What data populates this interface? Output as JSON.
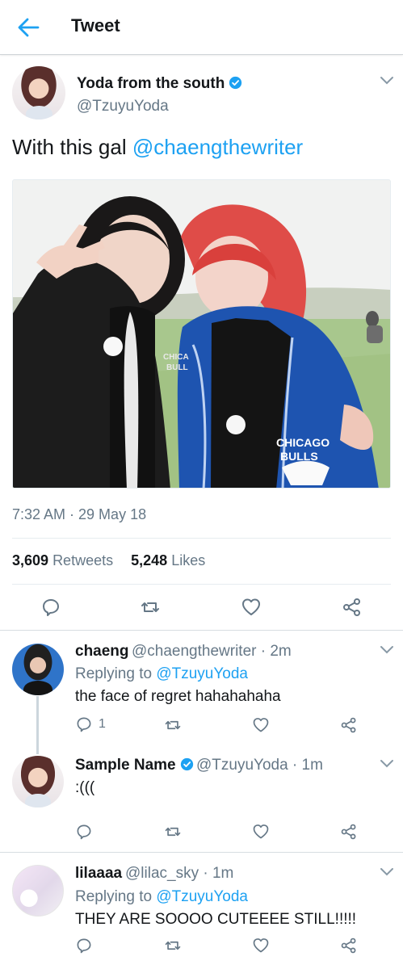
{
  "header": {
    "title": "Tweet"
  },
  "tweet": {
    "author_name": "Yoda from the south",
    "author_handle": "@TzuyuYoda",
    "text_prefix": "With this gal ",
    "mention": "@chaengthewriter",
    "timestamp": "7:32 AM · 29 May 18",
    "retweets_count": "3,609",
    "retweets_label": "Retweets",
    "likes_count": "5,248",
    "likes_label": "Likes",
    "photo_text": {
      "jacket_left": "CHICA\nBULL",
      "jacket_right_1": "CHICAGO",
      "jacket_right_2": "BULLS"
    }
  },
  "replies": [
    {
      "name": "chaeng",
      "handle_time": "@chaengthewriter · 2m",
      "replying_prefix": "Replying to ",
      "replying_to": "@TzuyuYoda",
      "text": "the face of regret hahahahaha",
      "reply_count": "1"
    },
    {
      "name": "Sample Name",
      "handle_time": "@TzuyuYoda · 1m",
      "text": ":((("
    },
    {
      "name": "lilaaaa",
      "handle_time": "@lilac_sky · 1m",
      "replying_prefix": "Replying to ",
      "replying_to": "@TzuyuYoda",
      "text": "THEY ARE SOOOO CUTEEEE STILL!!!!!"
    }
  ],
  "colors": {
    "accent": "#1da1f2",
    "text": "#14171a",
    "secondary": "#657786",
    "divider": "#e6ecf0"
  },
  "icons": [
    "back-arrow-icon",
    "verified-badge-icon",
    "chevron-down-icon",
    "reply-icon",
    "retweet-icon",
    "like-icon",
    "share-icon"
  ]
}
